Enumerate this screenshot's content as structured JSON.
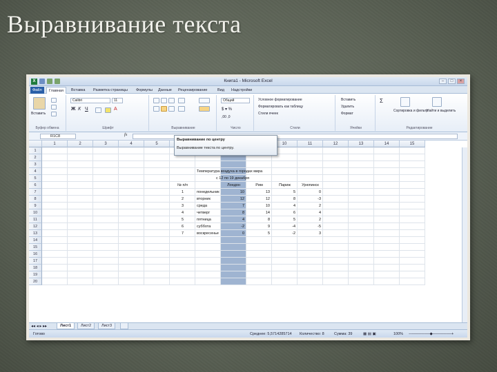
{
  "slide": {
    "title": "Выравнивание текста"
  },
  "window": {
    "title": "Книга1 - Microsoft Excel"
  },
  "ribbon_tabs": [
    "Файл",
    "Главная",
    "Вставка",
    "Разметка страницы",
    "Формулы",
    "Данные",
    "Рецензирование",
    "Вид",
    "Надстройки"
  ],
  "ribbon": {
    "paste": "Вставить",
    "font_name": "Calibri",
    "font_size": "11",
    "format_general": "Общий",
    "cond_format": "Условное форматирование",
    "format_table": "Форматировать как таблицу",
    "cell_styles": "Стили ячеек",
    "insert": "Вставить",
    "delete": "Удалить",
    "format": "Формат",
    "sort_filter": "Сортировка и фильтр",
    "find_select": "Найти и выделить",
    "groups": {
      "clipboard": "Буфер обмена",
      "font": "Шрифт",
      "alignment": "Выравнивание",
      "number": "Число",
      "styles": "Стили",
      "cells": "Ячейки",
      "editing": "Редактирование"
    }
  },
  "formula_bar": {
    "name_box": "R1C8",
    "fx": "fx"
  },
  "tooltip": {
    "title": "Выравнивание по центру",
    "body": "Выравнивание текста по центру."
  },
  "columns": [
    "1",
    "2",
    "3",
    "4",
    "5",
    "6",
    "7",
    "8",
    "9",
    "10",
    "11",
    "12",
    "13",
    "14",
    "15"
  ],
  "rows": [
    "1",
    "2",
    "3",
    "4",
    "5",
    "6",
    "7",
    "8",
    "9",
    "10",
    "11",
    "12",
    "13",
    "14",
    "15",
    "16",
    "17",
    "18",
    "19",
    "20"
  ],
  "table": {
    "title": "Температура воздуха в городах мира",
    "subtitle": "с 12 по 19 декабря",
    "headers": [
      "№ п/п",
      "",
      "Лондон",
      "Рим",
      "Париж",
      "Урюпинск"
    ],
    "rows": [
      {
        "n": "1",
        "day": "понедельник",
        "london": "10",
        "rome": "13",
        "paris": "5",
        "uryupinsk": "0"
      },
      {
        "n": "2",
        "day": "вторник",
        "london": "12",
        "rome": "12",
        "paris": "8",
        "uryupinsk": "-3"
      },
      {
        "n": "3",
        "day": "среда",
        "london": "7",
        "rome": "10",
        "paris": "4",
        "uryupinsk": "2"
      },
      {
        "n": "4",
        "day": "четверг",
        "london": "8",
        "rome": "14",
        "paris": "6",
        "uryupinsk": "4"
      },
      {
        "n": "5",
        "day": "пятница",
        "london": "4",
        "rome": "8",
        "paris": "5",
        "uryupinsk": "2"
      },
      {
        "n": "6",
        "day": "суббота",
        "london": "-2",
        "rome": "9",
        "paris": "-4",
        "uryupinsk": "-5"
      },
      {
        "n": "7",
        "day": "воскресенье",
        "london": "0",
        "rome": "5",
        "paris": "-2",
        "uryupinsk": "3"
      }
    ]
  },
  "sheets": [
    "Лист1",
    "Лист2",
    "Лист3"
  ],
  "status": {
    "ready": "Готово",
    "average": "Среднее: 5,5714285714",
    "count": "Количество: 8",
    "sum": "Сумма: 39",
    "zoom": "100%"
  }
}
